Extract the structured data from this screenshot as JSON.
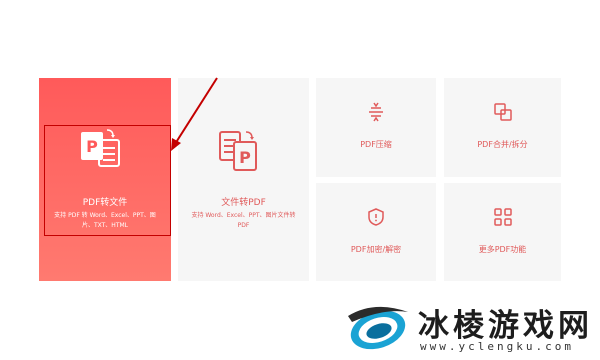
{
  "tools": {
    "pdf_to_file": {
      "title": "PDF转文件",
      "desc": "支持 PDF 转 Word、Excel、PPT、图片、TXT、HTML",
      "icon": "pdf-to-file-icon"
    },
    "file_to_pdf": {
      "title": "文件转PDF",
      "desc": "支持 Word、Excel、PPT、图片文件转 PDF",
      "icon": "file-to-pdf-icon"
    },
    "compress": {
      "title": "PDF压缩",
      "icon": "compress-icon"
    },
    "merge_split": {
      "title": "PDF合并/拆分",
      "icon": "merge-split-icon"
    },
    "encrypt": {
      "title": "PDF加密/解密",
      "icon": "shield-icon"
    },
    "more": {
      "title": "更多PDF功能",
      "icon": "grid-icon"
    }
  },
  "watermark": {
    "title": "冰棱游戏网",
    "url": "www.yclengku.com"
  },
  "colors": {
    "accent": "#ff5a5a",
    "accent_text": "#e05a5a",
    "card_bg": "#f6f6f6",
    "annotation": "#c40000"
  }
}
